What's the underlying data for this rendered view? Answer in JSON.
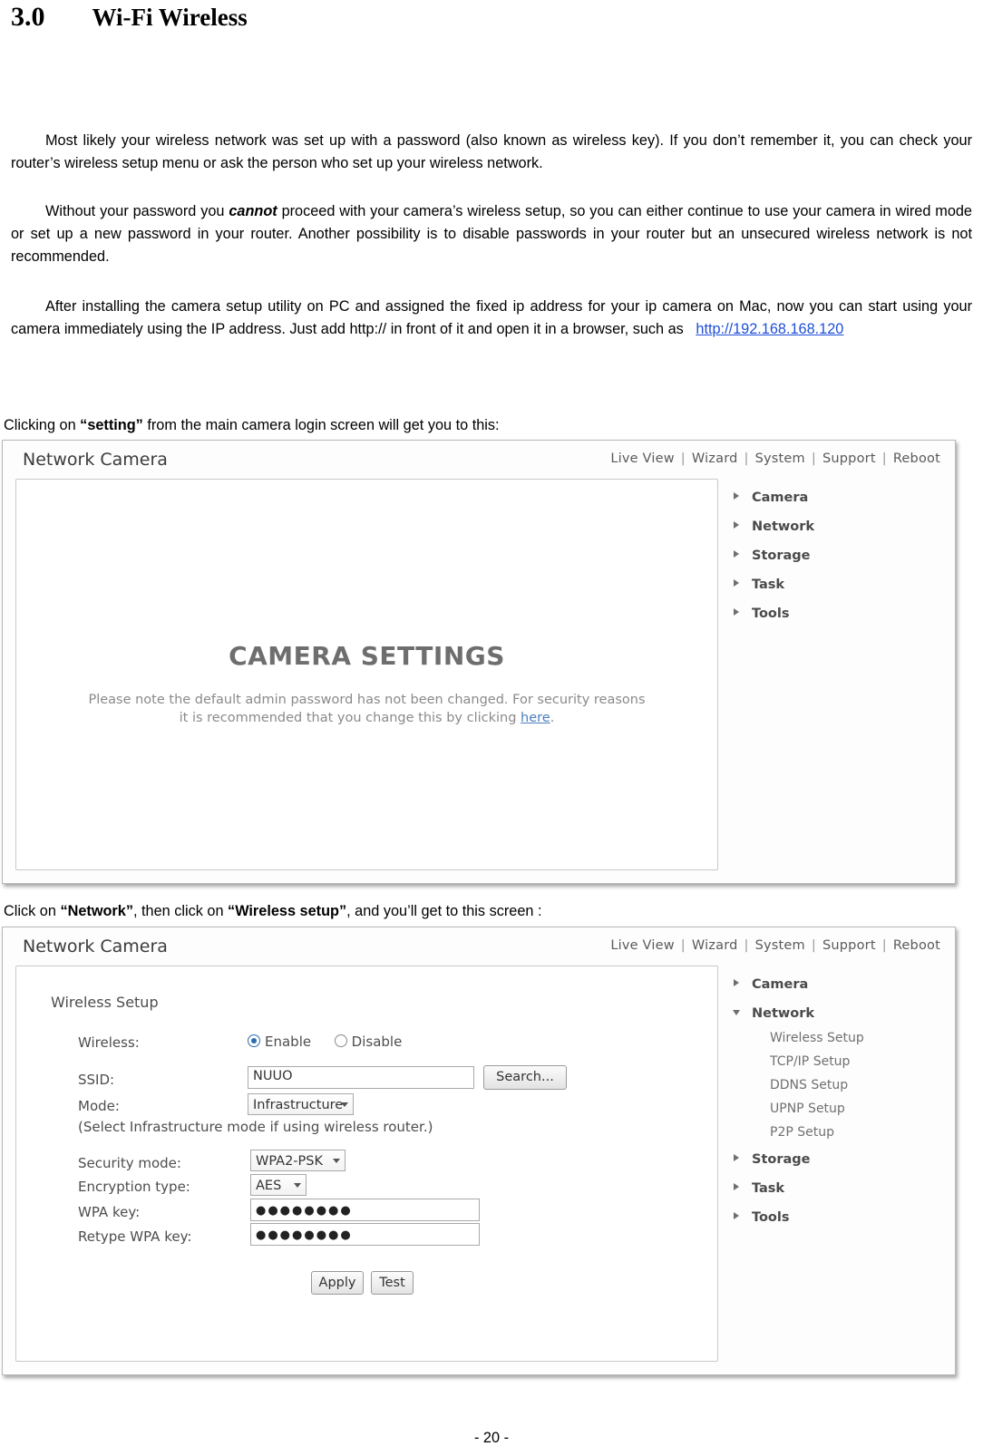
{
  "heading": {
    "number": "3.0",
    "title": "Wi-Fi Wireless"
  },
  "paragraphs": {
    "p1_a": "Most likely your wireless network was set up with a password (also known as wireless key). If you don’t remember it, you can check your router’s wireless setup menu or ask the person who set up your wireless network.",
    "p2_a": "Without your password you ",
    "p2_em": "cannot",
    "p2_b": " proceed with your camera’s wireless setup, so you can either continue to use your camera in wired mode or set up a new password in your router. Another possibility is to disable passwords in your router but an unsecured wireless network is not recommended.",
    "p3_a": "After installing the camera setup utility on PC and assigned the fixed ip address for your ip camera on Mac, now you can start using your camera immediately using the IP address. Just add http:// in front of it and open it in a browser, such as ",
    "p3_link": "http://192.168.168.120"
  },
  "captions": {
    "c1_a": "Clicking on ",
    "c1_b": "“setting”",
    "c1_c": " from the main camera login screen will get you to this:",
    "c2_a": "Click on ",
    "c2_b": "“Network”",
    "c2_c": ", then click on ",
    "c2_d": "“Wireless setup”",
    "c2_e": ", and you’ll get to this screen :"
  },
  "screenshot1": {
    "app_title": "Network Camera",
    "topnav": [
      "Live View",
      "Wizard",
      "System",
      "Support",
      "Reboot"
    ],
    "heading": "CAMERA SETTINGS",
    "note_line1": "Please note the default admin password has not been changed. For security reasons",
    "note_line2_a": "it is recommended that you change this by clicking ",
    "note_link": "here",
    "note_line2_b": ".",
    "tree": [
      {
        "label": "Camera",
        "state": "collapsed"
      },
      {
        "label": "Network",
        "state": "collapsed"
      },
      {
        "label": "Storage",
        "state": "collapsed"
      },
      {
        "label": "Task",
        "state": "collapsed"
      },
      {
        "label": "Tools",
        "state": "collapsed"
      }
    ]
  },
  "screenshot2": {
    "app_title": "Network Camera",
    "topnav": [
      "Live View",
      "Wizard",
      "System",
      "Support",
      "Reboot"
    ],
    "form_title": "Wireless Setup",
    "fields": {
      "wireless_label": "Wireless:",
      "wireless_enable": "Enable",
      "wireless_disable": "Disable",
      "wireless_selected": "Enable",
      "ssid_label": "SSID:",
      "ssid_value": "NUUO",
      "search_button": "Search...",
      "mode_label": "Mode:",
      "mode_value": "Infrastructure",
      "mode_hint": "(Select Infrastructure mode if using wireless router.)",
      "security_label": "Security mode:",
      "security_value": "WPA2-PSK",
      "encryption_label": "Encryption type:",
      "encryption_value": "AES",
      "wpa_key_label": "WPA key:",
      "wpa_key_value": "●●●●●●●●",
      "retype_key_label": "Retype WPA key:",
      "retype_key_value": "●●●●●●●●",
      "apply_button": "Apply",
      "test_button": "Test"
    },
    "tree": [
      {
        "label": "Camera",
        "state": "collapsed"
      },
      {
        "label": "Network",
        "state": "expanded"
      },
      {
        "label": "Storage",
        "state": "collapsed"
      },
      {
        "label": "Task",
        "state": "collapsed"
      },
      {
        "label": "Tools",
        "state": "collapsed"
      }
    ],
    "tree_sub": [
      "Wireless Setup",
      "TCP/IP Setup",
      "DDNS Setup",
      "UPNP Setup",
      "P2P Setup"
    ]
  },
  "footer": "- 20 -"
}
